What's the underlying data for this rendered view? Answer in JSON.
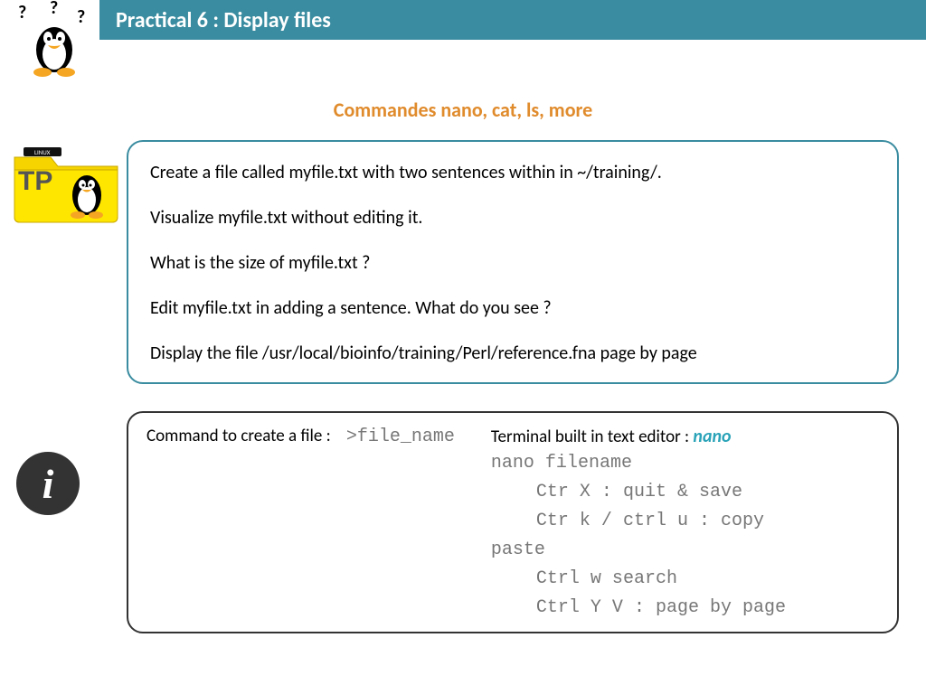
{
  "header": {
    "title": "Practical 6 : Display files"
  },
  "subtitle": "Commandes nano, cat, ls, more",
  "questions": [
    "Create a file called myfile.txt with two sentences within in ~/training/.",
    "Visualize myfile.txt without editing it.",
    "What is the size of myfile.txt ?",
    "Edit myfile.txt in adding a sentence. What do you see ?",
    "Display the file /usr/local/bioinfo/training/Perl/reference.fna page by page"
  ],
  "info": {
    "left_label": "Command to create a file :",
    "left_code": ">file_name",
    "right_label": "Terminal built in text editor :",
    "right_tool": "nano",
    "nano_usage": "nano filename",
    "shortcuts": [
      "Ctr X : quit & save",
      "Ctr k / ctrl u : copy",
      "Ctrl w search",
      "Ctrl Y V : page by page"
    ],
    "paste_line": "paste"
  },
  "tp_label": "TP",
  "info_glyph": "i"
}
